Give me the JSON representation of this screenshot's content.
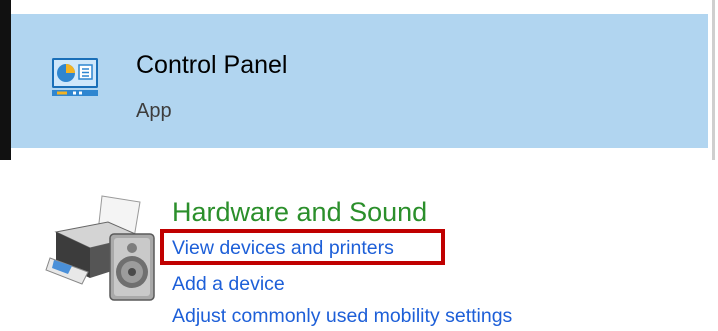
{
  "search_result": {
    "title": "Control Panel",
    "subtitle": "App",
    "icon": "control-panel-icon",
    "highlight_color": "#b1d5f0"
  },
  "category": {
    "title": "Hardware and Sound",
    "icon": "hardware-and-sound-icon",
    "title_color": "#2b8f2b",
    "links": [
      {
        "label": "View devices and printers",
        "highlighted": true
      },
      {
        "label": "Add a device",
        "highlighted": false
      },
      {
        "label": "Adjust commonly used mobility settings",
        "highlighted": false
      }
    ],
    "link_color": "#1d5fd8",
    "annotation_color": "#c00000"
  }
}
